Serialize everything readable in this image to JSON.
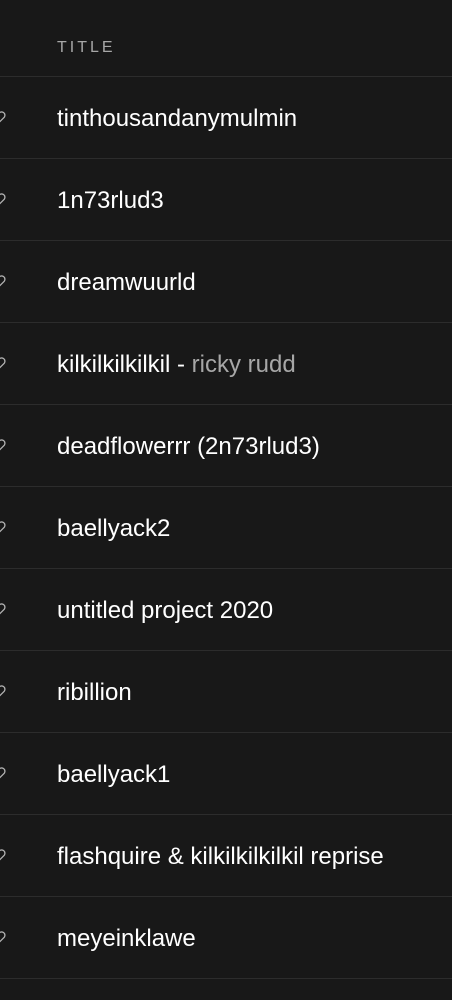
{
  "header": {
    "title": "TITLE"
  },
  "icons": {
    "row_icon": "heart-icon"
  },
  "colors": {
    "background": "#181818",
    "text_primary": "#ffffff",
    "text_secondary": "#a7a7a7",
    "divider": "#2c2c2c"
  },
  "tracks": [
    {
      "title": "tinthousandanymulmin"
    },
    {
      "title": "1n73rlud3"
    },
    {
      "title": "dreamwuurld"
    },
    {
      "title": "kilkilkilkilkil",
      "separator": " - ",
      "artist": "ricky rudd"
    },
    {
      "title": "deadflowerrr (2n73rlud3)"
    },
    {
      "title": "baellyack2"
    },
    {
      "title": "untitled project 2020"
    },
    {
      "title": "ribillion"
    },
    {
      "title": "baellyack1"
    },
    {
      "title": "flashquire & kilkilkilkilkil reprise"
    },
    {
      "title": "meyeinklawe"
    }
  ]
}
